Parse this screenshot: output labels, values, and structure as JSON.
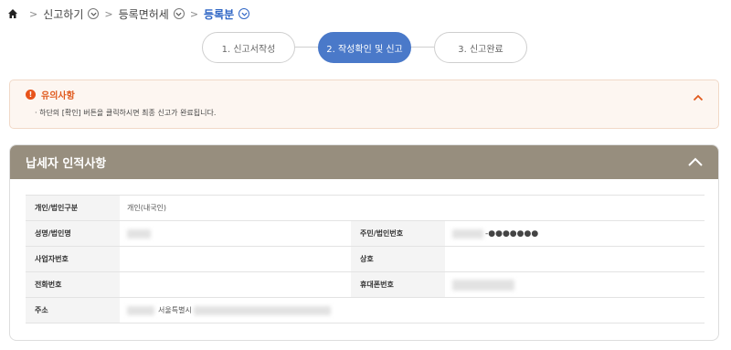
{
  "breadcrumb": {
    "items": [
      {
        "label": "신고하기"
      },
      {
        "label": "등록면허세"
      },
      {
        "label": "등록분"
      }
    ]
  },
  "steps": [
    {
      "label": "1. 신고서작성"
    },
    {
      "label": "2. 작성확인 및 신고"
    },
    {
      "label": "3. 신고완료"
    }
  ],
  "notice": {
    "title": "유의사항",
    "text": "· 하단의 [확인] 버튼을 클릭하시면 최종 신고가 완료됩니다."
  },
  "section": {
    "title": "납세자 인적사항",
    "rows": {
      "type_label": "개인/법인구분",
      "type_value": "개인(내국인)",
      "name_label": "성명/법인명",
      "id_label": "주민/법인번호",
      "id_value_masked": "-●●●●●●●",
      "bizno_label": "사업자번호",
      "company_label": "상호",
      "phone_label": "전화번호",
      "mobile_label": "휴대폰번호",
      "address_label": "주소",
      "address_value": "서울특별시"
    }
  },
  "colors": {
    "accent": "#4a79c9",
    "section_header": "#978e7e",
    "notice_bg": "#fdf6f1",
    "notice_accent": "#e05a1e"
  }
}
